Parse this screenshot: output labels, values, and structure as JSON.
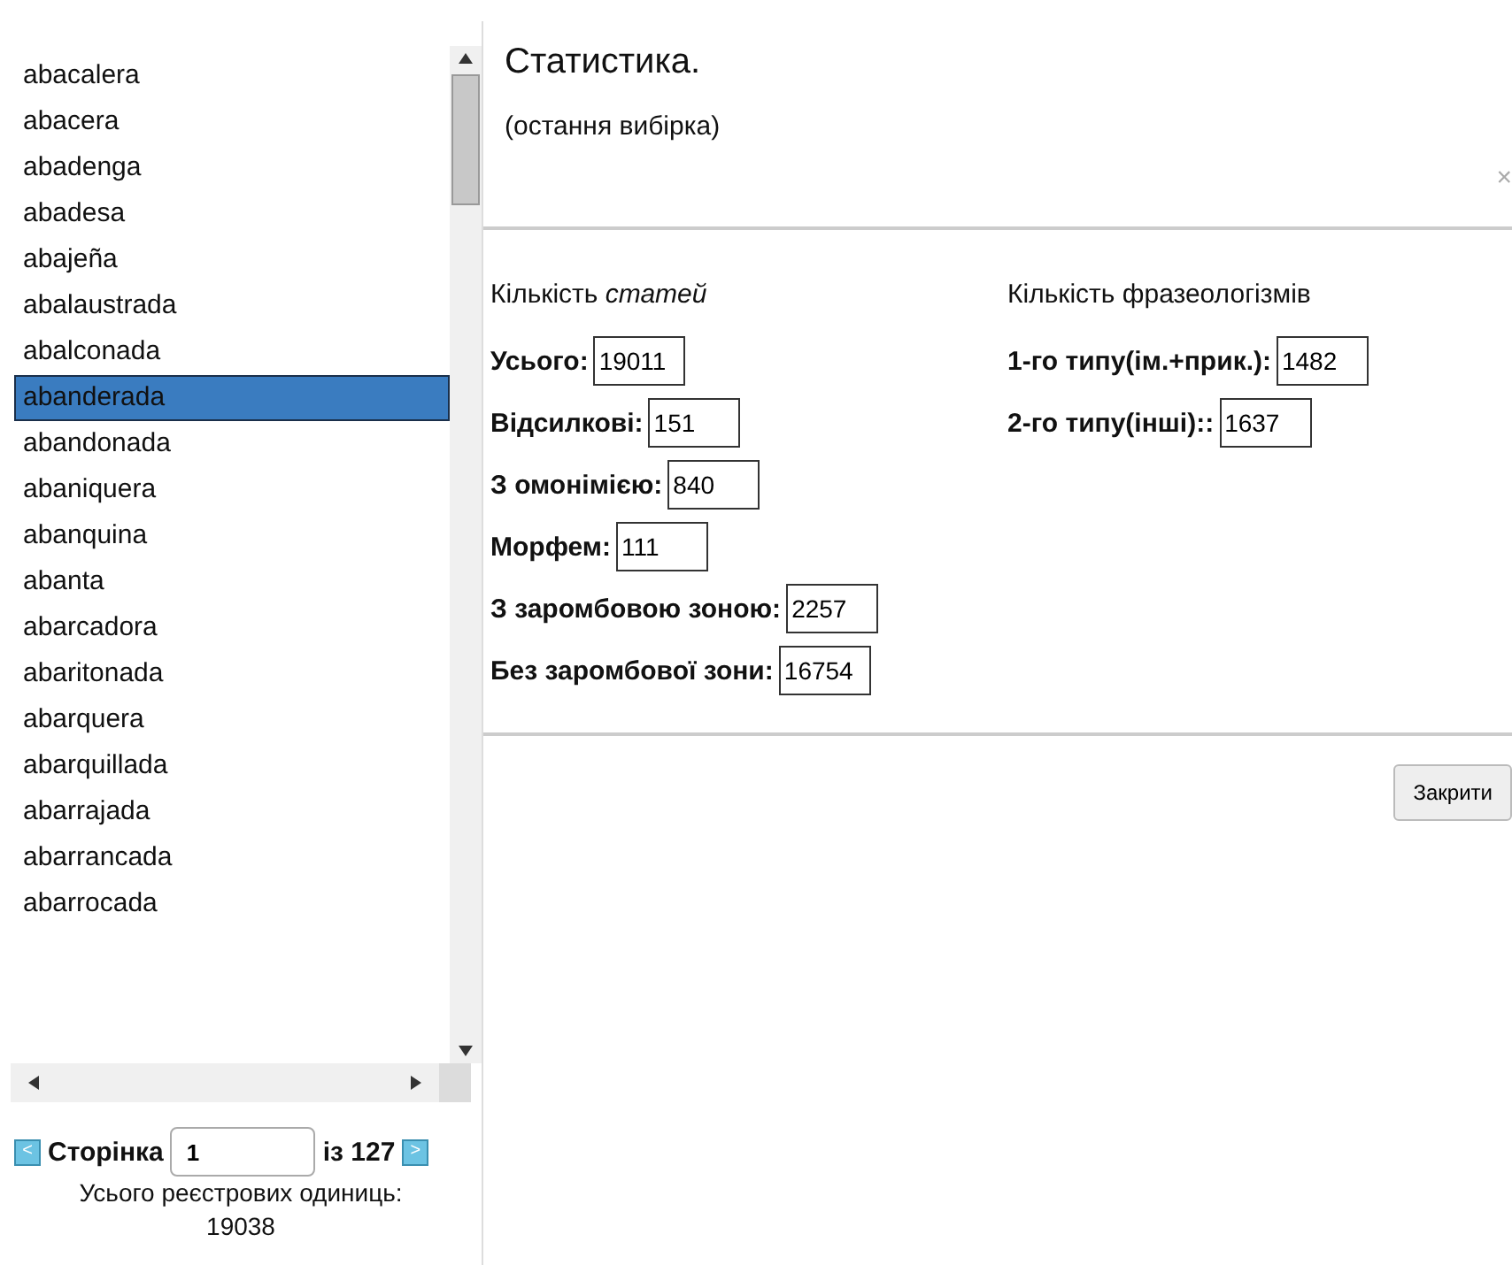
{
  "word_list": {
    "items": [
      {
        "label": "abacalera",
        "selected": false
      },
      {
        "label": "abacera",
        "selected": false
      },
      {
        "label": "abadenga",
        "selected": false
      },
      {
        "label": "abadesa",
        "selected": false
      },
      {
        "label": "abajeña",
        "selected": false
      },
      {
        "label": "abalaustrada",
        "selected": false
      },
      {
        "label": "abalconada",
        "selected": false
      },
      {
        "label": "abanderada",
        "selected": true
      },
      {
        "label": "abandonada",
        "selected": false
      },
      {
        "label": "abaniquera",
        "selected": false
      },
      {
        "label": "abanquina",
        "selected": false
      },
      {
        "label": "abanta",
        "selected": false
      },
      {
        "label": "abarcadora",
        "selected": false
      },
      {
        "label": "abaritonada",
        "selected": false
      },
      {
        "label": "abarquera",
        "selected": false
      },
      {
        "label": "abarquillada",
        "selected": false
      },
      {
        "label": "abarrajada",
        "selected": false
      },
      {
        "label": "abarrancada",
        "selected": false
      },
      {
        "label": "abarrocada",
        "selected": false
      }
    ]
  },
  "pager": {
    "prev": "<",
    "label": "Сторінка",
    "page": "1",
    "of": "із 127",
    "next": ">",
    "total_label": "Усього реєстрових одиниць:",
    "total": "19038"
  },
  "dialog": {
    "title": "Статистика.",
    "subtitle": "(остання вибірка)",
    "close_icon": "×",
    "left": {
      "heading": "Кількість *статей*",
      "rows": [
        {
          "label": "Усього:",
          "value": "19011"
        },
        {
          "label": "Відсилкові:",
          "value": "151"
        },
        {
          "label": "З омонімією:",
          "value": "840"
        },
        {
          "label": "Морфем:",
          "value": "111"
        },
        {
          "label": "З заромбовою зоною:",
          "value": "2257"
        },
        {
          "label": "Без заромбової зони:",
          "value": "16754"
        }
      ]
    },
    "right": {
      "heading": "Кількість фразеологізмів",
      "rows": [
        {
          "label": "1-го типу(ім.+прик.):",
          "value": "1482"
        },
        {
          "label": "2-го типу(інші)::",
          "value": "1637"
        }
      ]
    },
    "close_button": "Закрити"
  }
}
